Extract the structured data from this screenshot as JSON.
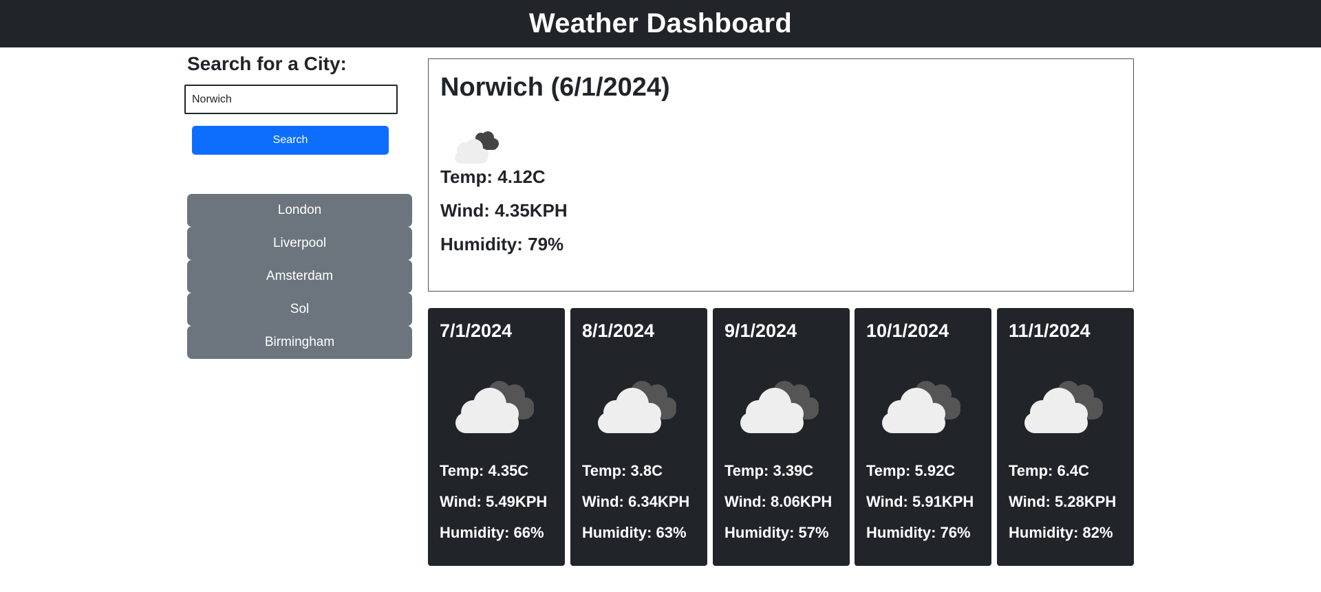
{
  "header": {
    "title": "Weather Dashboard"
  },
  "search": {
    "heading": "Search for a City:",
    "input_value": "Norwich",
    "button_label": "Search"
  },
  "history": [
    "London",
    "Liverpool",
    "Amsterdam",
    "Sol",
    "Birmingham"
  ],
  "current": {
    "title": "Norwich (6/1/2024)",
    "icon": "partly-cloudy-icon",
    "temp": "Temp: 4.12C",
    "wind": "Wind: 4.35KPH",
    "humidity": "Humidity: 79%"
  },
  "forecast": [
    {
      "date": "7/1/2024",
      "icon": "cloudy-icon",
      "temp": "Temp: 4.35C",
      "wind": "Wind: 5.49KPH",
      "humidity": "Humidity: 66%"
    },
    {
      "date": "8/1/2024",
      "icon": "cloudy-icon",
      "temp": "Temp: 3.8C",
      "wind": "Wind: 6.34KPH",
      "humidity": "Humidity: 63%"
    },
    {
      "date": "9/1/2024",
      "icon": "cloudy-icon",
      "temp": "Temp: 3.39C",
      "wind": "Wind: 8.06KPH",
      "humidity": "Humidity: 57%"
    },
    {
      "date": "10/1/2024",
      "icon": "cloudy-icon",
      "temp": "Temp: 5.92C",
      "wind": "Wind: 5.91KPH",
      "humidity": "Humidity: 76%"
    },
    {
      "date": "11/1/2024",
      "icon": "cloudy-icon",
      "temp": "Temp: 6.4C",
      "wind": "Wind: 5.28KPH",
      "humidity": "Humidity: 82%"
    }
  ],
  "colors": {
    "header_bg": "#212529",
    "primary": "#0d6efd",
    "secondary": "#6c757d",
    "card_bg": "#212529"
  }
}
